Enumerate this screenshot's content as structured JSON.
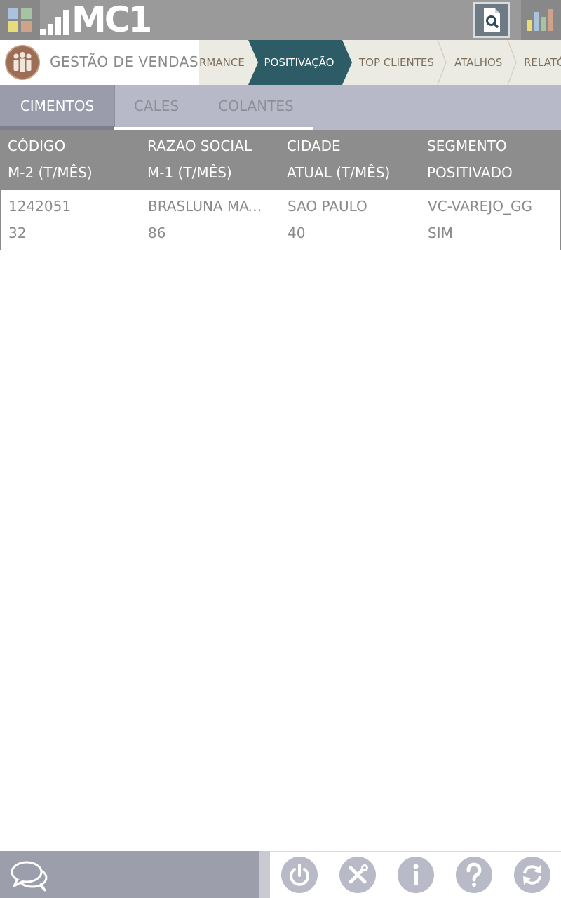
{
  "app": {
    "logo_text": "MC1",
    "module_title": "GESTÃO DE VENDAS"
  },
  "breadcrumbs": [
    {
      "label": "RMANCE",
      "active": false
    },
    {
      "label": "POSITIVAÇÃO",
      "active": true
    },
    {
      "label": "TOP CLIENTES",
      "active": false
    },
    {
      "label": "ATALHOS",
      "active": false
    },
    {
      "label": "RELATÓ",
      "active": false
    }
  ],
  "tabs": [
    {
      "label": "CIMENTOS",
      "active": true
    },
    {
      "label": "CALES",
      "active": false
    },
    {
      "label": "COLANTES",
      "active": false
    }
  ],
  "table": {
    "headers": [
      [
        "CÓDIGO",
        "M-2 (T/MÊS)"
      ],
      [
        "RAZAO SOCIAL",
        "M-1 (T/MÊS)"
      ],
      [
        "CIDADE",
        "ATUAL (T/MÊS)"
      ],
      [
        "SEGMENTO",
        "POSITIVADO"
      ]
    ],
    "rows": [
      {
        "codigo": "1242051",
        "m2": "32",
        "razao_social": "BRASLUNA MATERIAIS",
        "m1": "86",
        "cidade": "SAO PAULO",
        "atual": "40",
        "segmento": "VC-VAREJO_GG",
        "positivado": "SIM"
      }
    ]
  },
  "icons": {
    "apps": "apps-grid-icon",
    "search": "document-search-icon",
    "reports": "bar-chart-icon",
    "chat": "chat-bubbles-icon",
    "power": "power-icon",
    "tools": "tools-icon",
    "info": "info-icon",
    "help": "help-icon",
    "refresh": "refresh-icon"
  },
  "colors": {
    "topbar": "#9a9a9a",
    "active_crumb": "#2e5c66",
    "tabs_bg": "#b7b9c8",
    "active_tab": "#9a9bab",
    "table_header": "#8d8d8d",
    "buttons": "#b9bac7"
  }
}
